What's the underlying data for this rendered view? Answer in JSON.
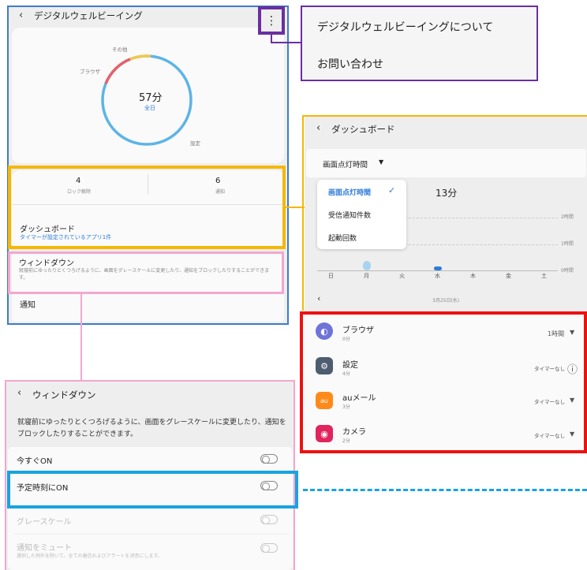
{
  "digital_wellbeing": {
    "title": "デジタルウェルビーイング",
    "chart_labels": {
      "other": "その他",
      "browser": "ブラウザ",
      "settings": "設定"
    },
    "total_time": "57分",
    "period": "全日",
    "lock_count": "4",
    "lock_label": "ロック解除",
    "notif_count": "6",
    "notif_label": "通知",
    "dashboard_title": "ダッシュボード",
    "dashboard_sub": "タイマーが設定されているアプリ1件",
    "winddown_title": "ウィンドダウン",
    "winddown_sub": "就寝前にゆったりとくつろげるように、画面をグレースケールに変更したり、通知をブロックしたりすることができます。",
    "notifications": "通知"
  },
  "menu": {
    "item1": "デジタルウェルビーイングについて",
    "item2": "お問い合わせ"
  },
  "dashboard": {
    "title": "ダッシュボード",
    "selector_label": "画面点灯時間",
    "selector_arrow": "▼",
    "options": [
      "画面点灯時間",
      "受信通知件数",
      "起動回数"
    ],
    "check_mark": "✓",
    "time_value": "13分",
    "y_labels": [
      "2時間",
      "1時間",
      "0時間"
    ],
    "days": [
      "日",
      "月",
      "火",
      "水",
      "木",
      "金",
      "土"
    ],
    "date_label": "3月25日(水)",
    "apps": [
      {
        "name": "ブラウザ",
        "time": "0分",
        "timer": "1時間",
        "ctrl": "▼"
      },
      {
        "name": "設定",
        "time": "4分",
        "timer": "タイマーなし",
        "ctrl": "ⓘ"
      },
      {
        "name": "auメール",
        "time": "3分",
        "timer": "タイマーなし",
        "ctrl": "▼",
        "icon_text": "au"
      },
      {
        "name": "カメラ",
        "time": "2分",
        "timer": "タイマーなし",
        "ctrl": "▼"
      }
    ]
  },
  "winddown": {
    "title": "ウィンドダウン",
    "description": "就寝前にゆったりとくつろげるように、画面をグレースケールに変更したり、通知をブロックしたりすることができます。",
    "now_on": "今すぐON",
    "scheduled_on": "予定時刻にON",
    "grayscale": "グレースケール",
    "mute_notifications": "通知をミュート",
    "mute_sub": "選択した例外を除いて、全ての着信およびアラートを消音にします。"
  },
  "chart_data": {
    "type": "bar",
    "categories": [
      "日",
      "月",
      "火",
      "水",
      "木",
      "金",
      "土"
    ],
    "values": [
      0,
      0.35,
      0,
      0.05,
      0,
      0,
      0
    ],
    "ylim": [
      0,
      2
    ]
  },
  "colors": {
    "purple_frame": "#6a2fa0",
    "blue_frame": "#3d7cc9",
    "orange_frame": "#f5b800",
    "pink_frame": "#f4a7cf",
    "red_frame": "#ee1111",
    "cyan_frame": "#19a3e0",
    "ring_blue": "#5cb4e6",
    "ring_red": "#e8606b",
    "ring_yellow": "#f2c94c"
  },
  "icons": [
    "back-chevron-icon",
    "more-vert-icon",
    "dropdown-arrow-icon",
    "check-icon",
    "info-icon"
  ]
}
